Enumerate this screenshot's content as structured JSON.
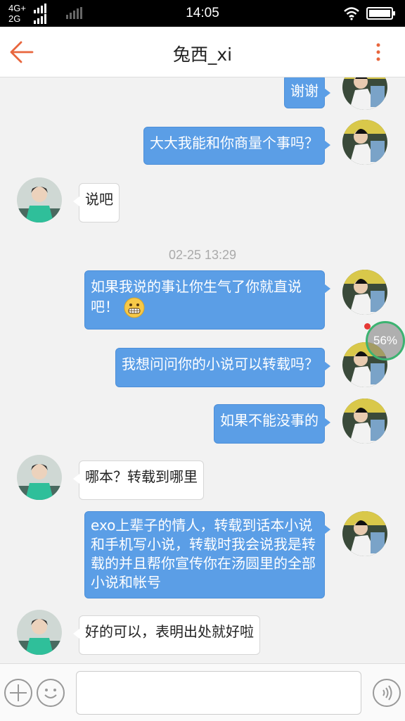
{
  "status_bar": {
    "network_top": "4G+",
    "network_bottom": "2G",
    "time": "14:05",
    "battery_level": 1.0
  },
  "nav": {
    "title": "兔西_xi",
    "accent_color": "#e8663d"
  },
  "messages": [
    {
      "sender": "me",
      "text": "谢谢"
    },
    {
      "sender": "me",
      "text": "大大我能和你商量个事吗？"
    },
    {
      "sender": "them",
      "text": "说吧"
    },
    {
      "type": "timestamp",
      "text": "02-25 13:29"
    },
    {
      "sender": "me",
      "text": "如果我说的事让你生气了你就直说吧！",
      "emoji": "grinning-emoji"
    },
    {
      "sender": "me",
      "text": "我想问问你的小说可以转载吗？"
    },
    {
      "sender": "me",
      "text": "如果不能没事的"
    },
    {
      "sender": "them",
      "text": "哪本？转载到哪里"
    },
    {
      "sender": "me",
      "text": "exo上辈子的情人，转载到话本小说和手机写小说，转载时我会说我是转载的并且帮你宣传你在汤圆里的全部小说和帐号"
    },
    {
      "sender": "them",
      "text": "好的可以，表明出处就好啦"
    }
  ],
  "floating_badge": {
    "text": "56%",
    "has_notification": true
  },
  "input_bar": {
    "message_value": "",
    "icons": [
      "plus-icon",
      "emoji-icon",
      "voice-icon"
    ]
  },
  "colors": {
    "my_bubble": "#5b9ee6",
    "their_bubble": "#ffffff"
  }
}
